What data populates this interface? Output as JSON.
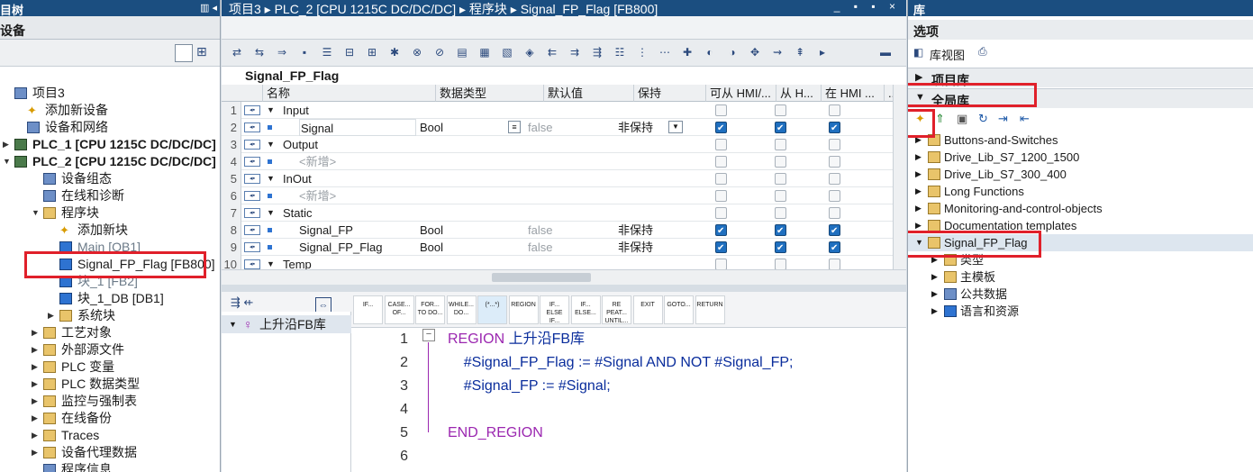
{
  "left": {
    "title": "目树",
    "subtitle": "设备",
    "tree": [
      {
        "label": "项目3",
        "indent": 0
      },
      {
        "label": "添加新设备",
        "indent": 1
      },
      {
        "label": "设备和网络",
        "indent": 1
      },
      {
        "label": "PLC_1 [CPU 1215C DC/DC/DC]",
        "indent": 0
      },
      {
        "label": "PLC_2 [CPU 1215C DC/DC/DC]",
        "indent": 0
      },
      {
        "label": "设备组态",
        "indent": 2
      },
      {
        "label": "在线和诊断",
        "indent": 2
      },
      {
        "label": "程序块",
        "indent": 2
      },
      {
        "label": "添加新块",
        "indent": 3
      },
      {
        "label": "Main [OB1]",
        "indent": 3
      },
      {
        "label": "Signal_FP_Flag [FB800]",
        "indent": 3
      },
      {
        "label": "块_1 [FB2]",
        "indent": 3
      },
      {
        "label": "块_1_DB [DB1]",
        "indent": 3
      },
      {
        "label": "系统块",
        "indent": 3
      },
      {
        "label": "工艺对象",
        "indent": 2
      },
      {
        "label": "外部源文件",
        "indent": 2
      },
      {
        "label": "PLC 变量",
        "indent": 2
      },
      {
        "label": "PLC 数据类型",
        "indent": 2
      },
      {
        "label": "监控与强制表",
        "indent": 2
      },
      {
        "label": "在线备份",
        "indent": 2
      },
      {
        "label": "Traces",
        "indent": 2
      },
      {
        "label": "设备代理数据",
        "indent": 2
      },
      {
        "label": "程序信息",
        "indent": 2
      }
    ]
  },
  "mid": {
    "breadcrumb": "项目3 ▸ PLC_2 [CPU 1215C DC/DC/DC] ▸ 程序块 ▸ Signal_FP_Flag [FB800]",
    "window_controls": "_ ▪ ▪ ×",
    "block_name": "Signal_FP_Flag",
    "columns": [
      "名称",
      "数据类型",
      "默认值",
      "保持",
      "可从 HMI/...",
      "从 H...",
      "在 HMI ...",
      "..."
    ],
    "rows": [
      {
        "n": "1",
        "name": "Input",
        "section": true
      },
      {
        "n": "2",
        "name": "Signal",
        "type": "Bool",
        "def": "false",
        "ret": "非保持",
        "c1": true,
        "c2": true,
        "c3": true,
        "selected": true
      },
      {
        "n": "3",
        "name": "Output",
        "section": true
      },
      {
        "n": "4",
        "name": "<新增>",
        "placeholder": true
      },
      {
        "n": "5",
        "name": "InOut",
        "section": true
      },
      {
        "n": "6",
        "name": "<新增>",
        "placeholder": true
      },
      {
        "n": "7",
        "name": "Static",
        "section": true
      },
      {
        "n": "8",
        "name": "Signal_FP",
        "type": "Bool",
        "def": "false",
        "ret": "非保持",
        "c1": true,
        "c2": true,
        "c3": true
      },
      {
        "n": "9",
        "name": "Signal_FP_Flag",
        "type": "Bool",
        "def": "false",
        "ret": "非保持",
        "c1": true,
        "c2": true,
        "c3": true
      },
      {
        "n": "10",
        "name": "Temp",
        "section": true
      }
    ],
    "snippets": [
      "IF...",
      "CASE... OF...",
      "FOR... TO DO...",
      "WHILE... DO...",
      "(*...*)",
      "REGION",
      "IF... ELSE IF...",
      "IF... ELSE...",
      "RE PEAT... UNTIL...",
      "EXIT",
      "GOTO...",
      "RETURN"
    ],
    "region_tree": "上升沿FB库",
    "code": [
      {
        "ln": "1",
        "parts": [
          [
            "kw",
            "REGION "
          ],
          [
            "blue",
            "上升沿FB库"
          ]
        ]
      },
      {
        "ln": "2",
        "parts": [
          [
            "id",
            "    #Signal_FP_Flag := #Signal "
          ],
          [
            "blue",
            "AND"
          ],
          [
            "id",
            " NOT #Signal_FP;"
          ]
        ]
      },
      {
        "ln": "3",
        "parts": [
          [
            "id",
            "    #Signal_FP := #Signal;"
          ]
        ]
      },
      {
        "ln": "4",
        "parts": []
      },
      {
        "ln": "5",
        "parts": [
          [
            "kw",
            "END_REGION"
          ]
        ]
      },
      {
        "ln": "6",
        "parts": []
      }
    ]
  },
  "right": {
    "title": "库",
    "options": "选项",
    "lib_view": "库视图",
    "project_lib": "项目库",
    "global_lib": "全局库",
    "items": [
      {
        "label": "Buttons-and-Switches",
        "indent": 0
      },
      {
        "label": "Drive_Lib_S7_1200_1500",
        "indent": 0
      },
      {
        "label": "Drive_Lib_S7_300_400",
        "indent": 0
      },
      {
        "label": "Long Functions",
        "indent": 0
      },
      {
        "label": "Monitoring-and-control-objects",
        "indent": 0
      },
      {
        "label": "Documentation templates",
        "indent": 0
      },
      {
        "label": "Signal_FP_Flag",
        "indent": 0,
        "open": true
      },
      {
        "label": "类型",
        "indent": 1
      },
      {
        "label": "主模板",
        "indent": 1
      },
      {
        "label": "公共数据",
        "indent": 1
      },
      {
        "label": "语言和资源",
        "indent": 1
      }
    ]
  }
}
